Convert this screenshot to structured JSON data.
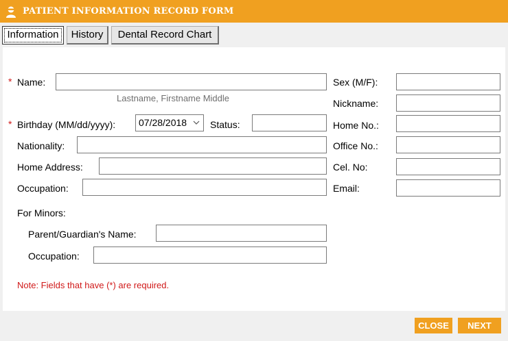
{
  "title": "PATIENT INFORMATION RECORD FORM",
  "tabs": [
    {
      "label": "Information",
      "active": true
    },
    {
      "label": "History"
    },
    {
      "label": "Dental Record Chart"
    }
  ],
  "form": {
    "required_mark": "*",
    "name_label": "Name:",
    "name_hint": "Lastname, Firstname Middle",
    "birthday_label": "Birthday (MM/dd/yyyy):",
    "birthday_value": "07/28/2018",
    "status_label": "Status:",
    "nationality_label": "Nationality:",
    "home_address_label": "Home Address:",
    "occupation_label": "Occupation:",
    "for_minors_label": "For Minors:",
    "guardian_name_label": "Parent/Guardian's Name:",
    "guardian_occupation_label": "Occupation:",
    "sex_label": "Sex (M/F):",
    "nickname_label": "Nickname:",
    "home_no_label": "Home No.:",
    "office_no_label": "Office No.:",
    "cel_no_label": "Cel. No:",
    "email_label": "Email:",
    "note": "Note: Fields that have (*) are required."
  },
  "buttons": {
    "close": "CLOSE",
    "next": "NEXT"
  },
  "colors": {
    "accent": "#f0a020",
    "required": "#d01818"
  }
}
